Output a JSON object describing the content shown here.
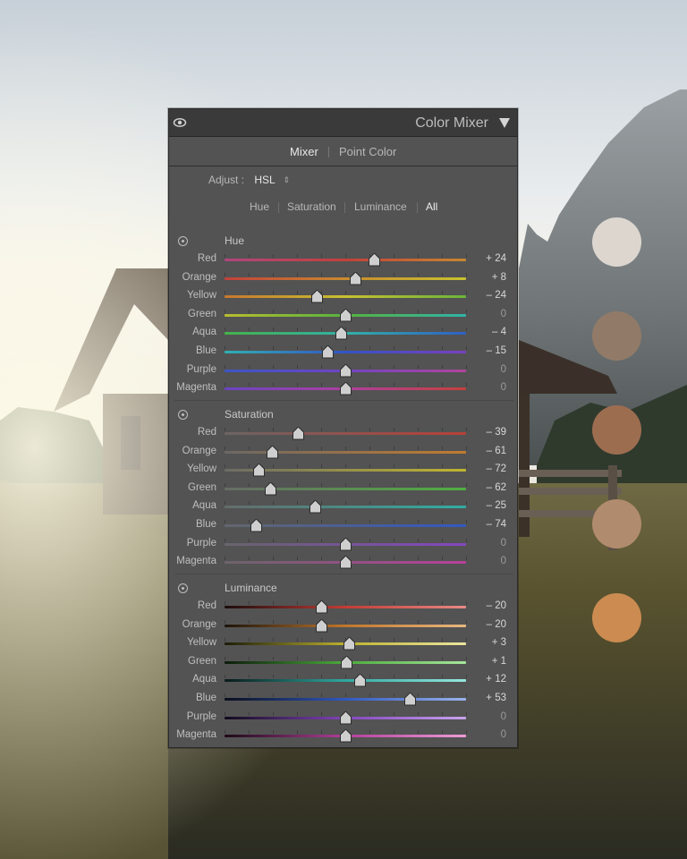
{
  "panel": {
    "title": "Color Mixer",
    "modes": [
      "Mixer",
      "Point Color"
    ],
    "active_mode": "Mixer",
    "adjust_label": "Adjust :",
    "adjust_value": "HSL",
    "tabs": [
      "Hue",
      "Saturation",
      "Luminance",
      "All"
    ],
    "active_tab": "All"
  },
  "sections": [
    {
      "title": "Hue",
      "rows": [
        {
          "label": "Red",
          "value": 24,
          "display": "+ 24"
        },
        {
          "label": "Orange",
          "value": 8,
          "display": "+ 8"
        },
        {
          "label": "Yellow",
          "value": -24,
          "display": "– 24"
        },
        {
          "label": "Green",
          "value": 0,
          "display": "0"
        },
        {
          "label": "Aqua",
          "value": -4,
          "display": "– 4"
        },
        {
          "label": "Blue",
          "value": -15,
          "display": "– 15"
        },
        {
          "label": "Purple",
          "value": 0,
          "display": "0"
        },
        {
          "label": "Magenta",
          "value": 0,
          "display": "0"
        }
      ]
    },
    {
      "title": "Saturation",
      "rows": [
        {
          "label": "Red",
          "value": -39,
          "display": "– 39"
        },
        {
          "label": "Orange",
          "value": -61,
          "display": "– 61"
        },
        {
          "label": "Yellow",
          "value": -72,
          "display": "– 72"
        },
        {
          "label": "Green",
          "value": -62,
          "display": "– 62"
        },
        {
          "label": "Aqua",
          "value": -25,
          "display": "– 25"
        },
        {
          "label": "Blue",
          "value": -74,
          "display": "– 74"
        },
        {
          "label": "Purple",
          "value": 0,
          "display": "0"
        },
        {
          "label": "Magenta",
          "value": 0,
          "display": "0"
        }
      ]
    },
    {
      "title": "Luminance",
      "rows": [
        {
          "label": "Red",
          "value": -20,
          "display": "– 20"
        },
        {
          "label": "Orange",
          "value": -20,
          "display": "– 20"
        },
        {
          "label": "Yellow",
          "value": 3,
          "display": "+ 3"
        },
        {
          "label": "Green",
          "value": 1,
          "display": "+ 1"
        },
        {
          "label": "Aqua",
          "value": 12,
          "display": "+ 12"
        },
        {
          "label": "Blue",
          "value": 53,
          "display": "+ 53"
        },
        {
          "label": "Purple",
          "value": 0,
          "display": "0"
        },
        {
          "label": "Magenta",
          "value": 0,
          "display": "0"
        }
      ]
    }
  ],
  "slider_range": [
    -100,
    100
  ],
  "gradients": {
    "Hue": {
      "Red": [
        "#b0457e",
        "#c4403a",
        "#c7872e"
      ],
      "Orange": [
        "#c4403a",
        "#c98a2e",
        "#c9c32e"
      ],
      "Yellow": [
        "#c9772e",
        "#c8c02f",
        "#6bb53a"
      ],
      "Green": [
        "#b8bd2e",
        "#56b33e",
        "#2fb3a8"
      ],
      "Aqua": [
        "#44b24a",
        "#32b0a6",
        "#2f60c4"
      ],
      "Blue": [
        "#2fb0b3",
        "#3353c6",
        "#7b3fc2"
      ],
      "Purple": [
        "#3b55c6",
        "#7044c3",
        "#b2449c"
      ],
      "Magenta": [
        "#6a44c4",
        "#ae3fa0",
        "#c8403c"
      ]
    },
    "Saturation": {
      "Red": [
        "#6c6464",
        "#b84038"
      ],
      "Orange": [
        "#6c6864",
        "#c17b2f"
      ],
      "Yellow": [
        "#6c6c64",
        "#c0b530"
      ],
      "Green": [
        "#666c64",
        "#4fb040"
      ],
      "Aqua": [
        "#646c6a",
        "#30ada3"
      ],
      "Blue": [
        "#64666c",
        "#3258c2"
      ],
      "Purple": [
        "#68646c",
        "#8446c0"
      ],
      "Magenta": [
        "#6c646a",
        "#b8409c"
      ]
    },
    "Luminance": {
      "Red": [
        "#1c0c0c",
        "#c23c34",
        "#e88a84"
      ],
      "Orange": [
        "#1c140a",
        "#c0762c",
        "#e8b880"
      ],
      "Yellow": [
        "#1c1c0a",
        "#bcb22e",
        "#ece6a0"
      ],
      "Green": [
        "#0c1c0c",
        "#4cab3c",
        "#a6e69c"
      ],
      "Aqua": [
        "#0a1a1a",
        "#2ea9a0",
        "#96e6de"
      ],
      "Blue": [
        "#0a0e1c",
        "#2f58c0",
        "#9ab4ee"
      ],
      "Purple": [
        "#120a1c",
        "#8244bc",
        "#c8a4ee"
      ],
      "Magenta": [
        "#1c0a16",
        "#b23e98",
        "#ee9cd8"
      ]
    }
  },
  "palette": [
    "#dcd6cf",
    "#917b68",
    "#9d6d50",
    "#b08b6d",
    "#cb8b51"
  ],
  "icons": {
    "visibility": "eye-icon",
    "collapse": "triangle-down-icon",
    "targeted_adjust": "target-icon",
    "thumb": "slider-thumb-icon"
  }
}
